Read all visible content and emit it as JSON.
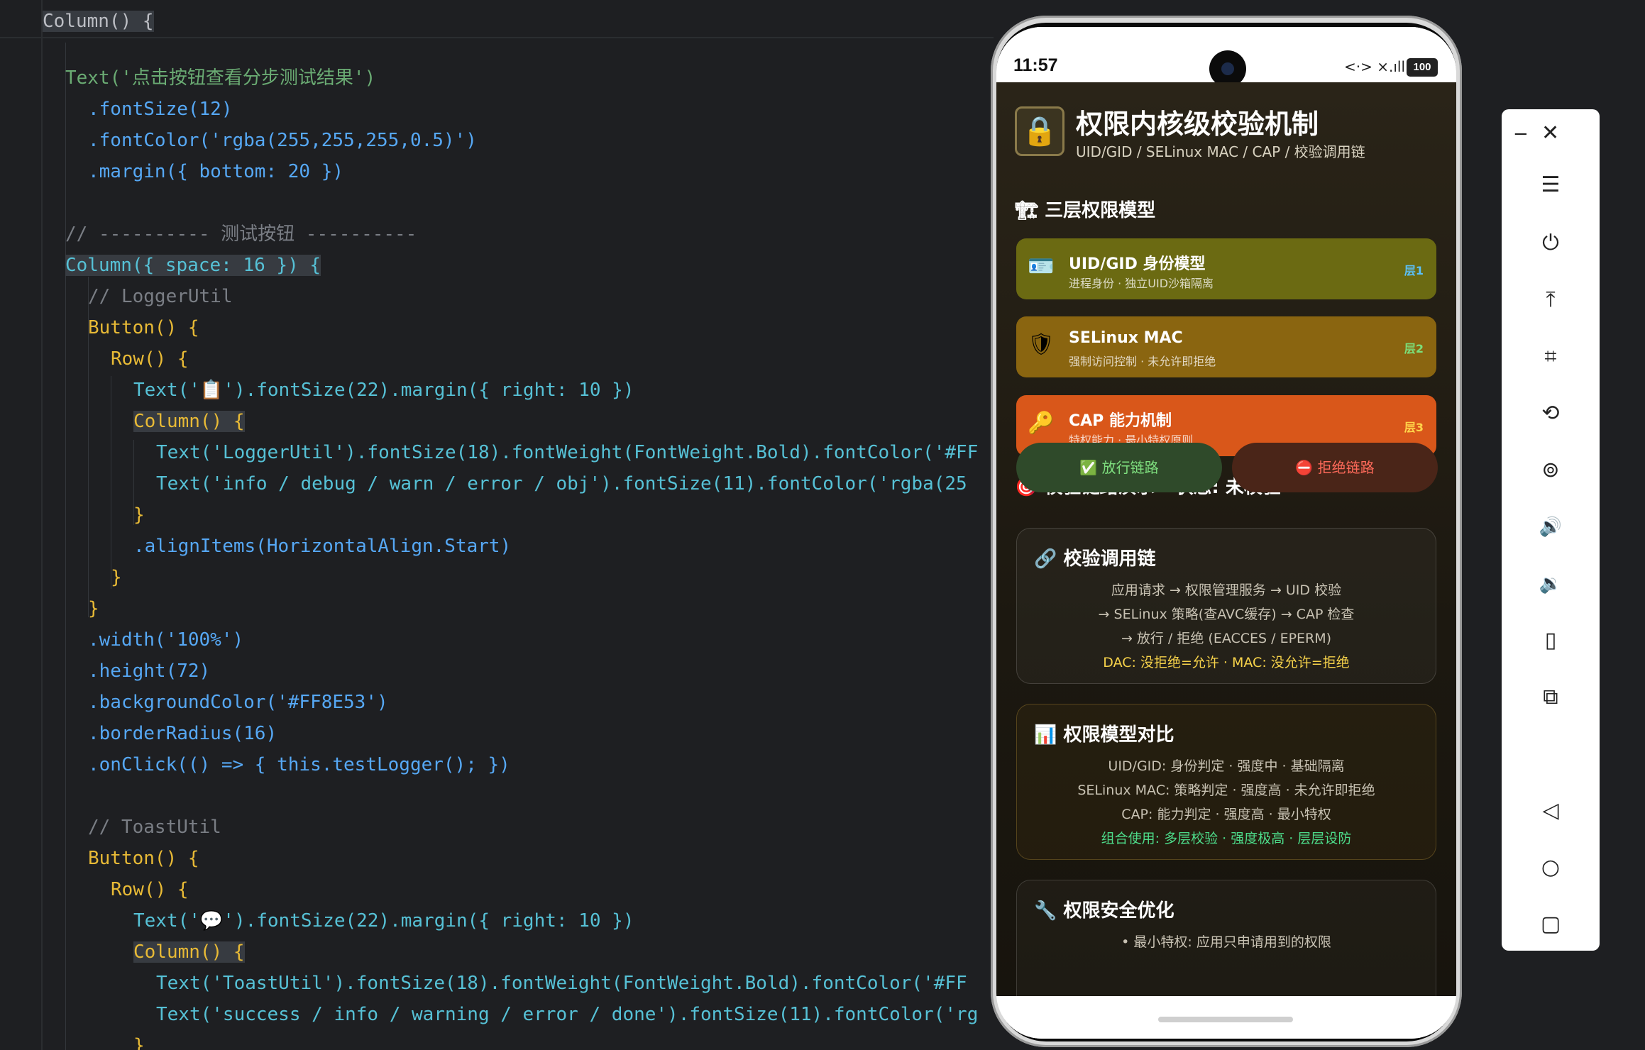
{
  "editor": {
    "lines": [
      {
        "key": "l0",
        "text": "Column() {"
      },
      {
        "key": "l1",
        "text": "Text('点击按钮查看分步测试结果')"
      },
      {
        "key": "l2",
        "text": ".fontSize(12)"
      },
      {
        "key": "l3",
        "text": ".fontColor('rgba(255,255,255,0.5)')"
      },
      {
        "key": "l4",
        "text": ".margin({ bottom: 20 })"
      },
      {
        "key": "l5",
        "text": "// ---------- 测试按钮 ----------"
      },
      {
        "key": "l6",
        "text": "Column({ space: 16 }) {"
      },
      {
        "key": "l7",
        "text": "// LoggerUtil"
      },
      {
        "key": "l8",
        "text": "Button() {"
      },
      {
        "key": "l9",
        "text": "Row() {"
      },
      {
        "key": "l10",
        "text": "Text('📋').fontSize(22).margin({ right: 10 })"
      },
      {
        "key": "l11",
        "text": "Column() {"
      },
      {
        "key": "l12",
        "text": "Text('LoggerUtil').fontSize(18).fontWeight(FontWeight.Bold).fontColor('#FF"
      },
      {
        "key": "l13",
        "text": "Text('info / debug / warn / error / obj').fontSize(11).fontColor('rgba(25"
      },
      {
        "key": "l14",
        "text": "}"
      },
      {
        "key": "l15",
        "text": ".alignItems(HorizontalAlign.Start)"
      },
      {
        "key": "l16",
        "text": "}"
      },
      {
        "key": "l17",
        "text": "}"
      },
      {
        "key": "l18",
        "text": ".width('100%')"
      },
      {
        "key": "l19",
        "text": ".height(72)"
      },
      {
        "key": "l20",
        "text": ".backgroundColor('#FF8E53')"
      },
      {
        "key": "l21",
        "text": ".borderRadius(16)"
      },
      {
        "key": "l22",
        "text": ".onClick(() => { this.testLogger(); })"
      },
      {
        "key": "l23",
        "text": "// ToastUtil"
      },
      {
        "key": "l24",
        "text": "Button() {"
      },
      {
        "key": "l25",
        "text": "Row() {"
      },
      {
        "key": "l26",
        "text": "Text('💬').fontSize(22).margin({ right: 10 })"
      },
      {
        "key": "l27",
        "text": "Column() {"
      },
      {
        "key": "l28",
        "text": "Text('ToastUtil').fontSize(18).fontWeight(FontWeight.Bold).fontColor('#FF"
      },
      {
        "key": "l29",
        "text": "Text('success / info / warning / error / done').fontSize(11).fontColor('rg"
      },
      {
        "key": "l30",
        "text": "}"
      }
    ]
  },
  "statusbar": {
    "time": "11:57",
    "signal_icons": "<·> ×.ıll",
    "battery": "100"
  },
  "app": {
    "title": "权限内核级校验机制",
    "subtitle": "UID/GID / SELinux MAC / CAP / 校验调用链",
    "lock_icon": "🔒",
    "section_model": {
      "icon": "🏗",
      "label": "三层权限模型"
    },
    "layers": [
      {
        "icon": "🪪",
        "title": "UID/GID 身份模型",
        "sub": "进程身份 · 独立UID沙箱隔离",
        "badge": "层1",
        "bg": "#6b6a12",
        "badge_color": "#5bc0f8"
      },
      {
        "icon": "🛡",
        "title": "SELinux MAC",
        "sub": "强制访问控制 · 未允许即拒绝",
        "badge": "层2",
        "bg": "#8a6510",
        "badge_color": "#7be07b"
      },
      {
        "icon": "🔑",
        "title": "CAP 能力机制",
        "sub": "特权能力 · 最小特权原则",
        "badge": "层3",
        "bg": "#d9571a",
        "badge_color": "#ffd54a"
      }
    ],
    "section_demo": {
      "icon": "🎯",
      "label": "校验链路演示 · 状态: 未校验"
    },
    "buttons": {
      "allow": {
        "icon": "✅",
        "label": "放行链路"
      },
      "deny": {
        "icon": "⛔",
        "label": "拒绝链路"
      }
    },
    "chain_card": {
      "icon": "🔗",
      "title": "校验调用链",
      "lines": [
        "应用请求 → 权限管理服务 → UID 校验",
        "→ SELinux 策略(查AVC缓存) → CAP 检查",
        "→ 放行 / 拒绝 (EACCES / EPERM)"
      ],
      "highlight": "DAC: 没拒绝=允许 · MAC: 没允许=拒绝",
      "highlight_color": "#f6d24a"
    },
    "compare_card": {
      "icon": "📊",
      "title": "权限模型对比",
      "lines": [
        "UID/GID: 身份判定 · 强度中 · 基础隔离",
        "SELinux MAC: 策略判定 · 强度高 · 未允许即拒绝",
        "CAP: 能力判定 · 强度高 · 最小特权"
      ],
      "highlight": "组合使用: 多层校验 · 强度极高 · 层层设防",
      "highlight_color": "#4ddc8a"
    },
    "optimize_card": {
      "icon": "🔧",
      "title": "权限安全优化",
      "line1": "• 最小特权: 应用只申请用到的权限"
    }
  },
  "toolbar": {
    "minimize": "−",
    "close": "✕",
    "items": [
      {
        "name": "menu-icon",
        "glyph": "☰"
      },
      {
        "name": "power-icon",
        "glyph": "⏻"
      },
      {
        "name": "pin-top-icon",
        "glyph": "⤒"
      },
      {
        "name": "crop-icon",
        "glyph": "⌗"
      },
      {
        "name": "rotate-icon",
        "glyph": "⟲"
      },
      {
        "name": "screenshot-icon",
        "glyph": "⊚"
      },
      {
        "name": "volume-up-icon",
        "glyph": "🔊"
      },
      {
        "name": "volume-down-icon",
        "glyph": "🔉"
      },
      {
        "name": "shake-icon",
        "glyph": "▯"
      },
      {
        "name": "multi-device-icon",
        "glyph": "⧉"
      },
      {
        "name": "back-icon",
        "glyph": "◁"
      },
      {
        "name": "home-icon",
        "glyph": "○"
      },
      {
        "name": "recent-icon",
        "glyph": "▢"
      }
    ]
  }
}
